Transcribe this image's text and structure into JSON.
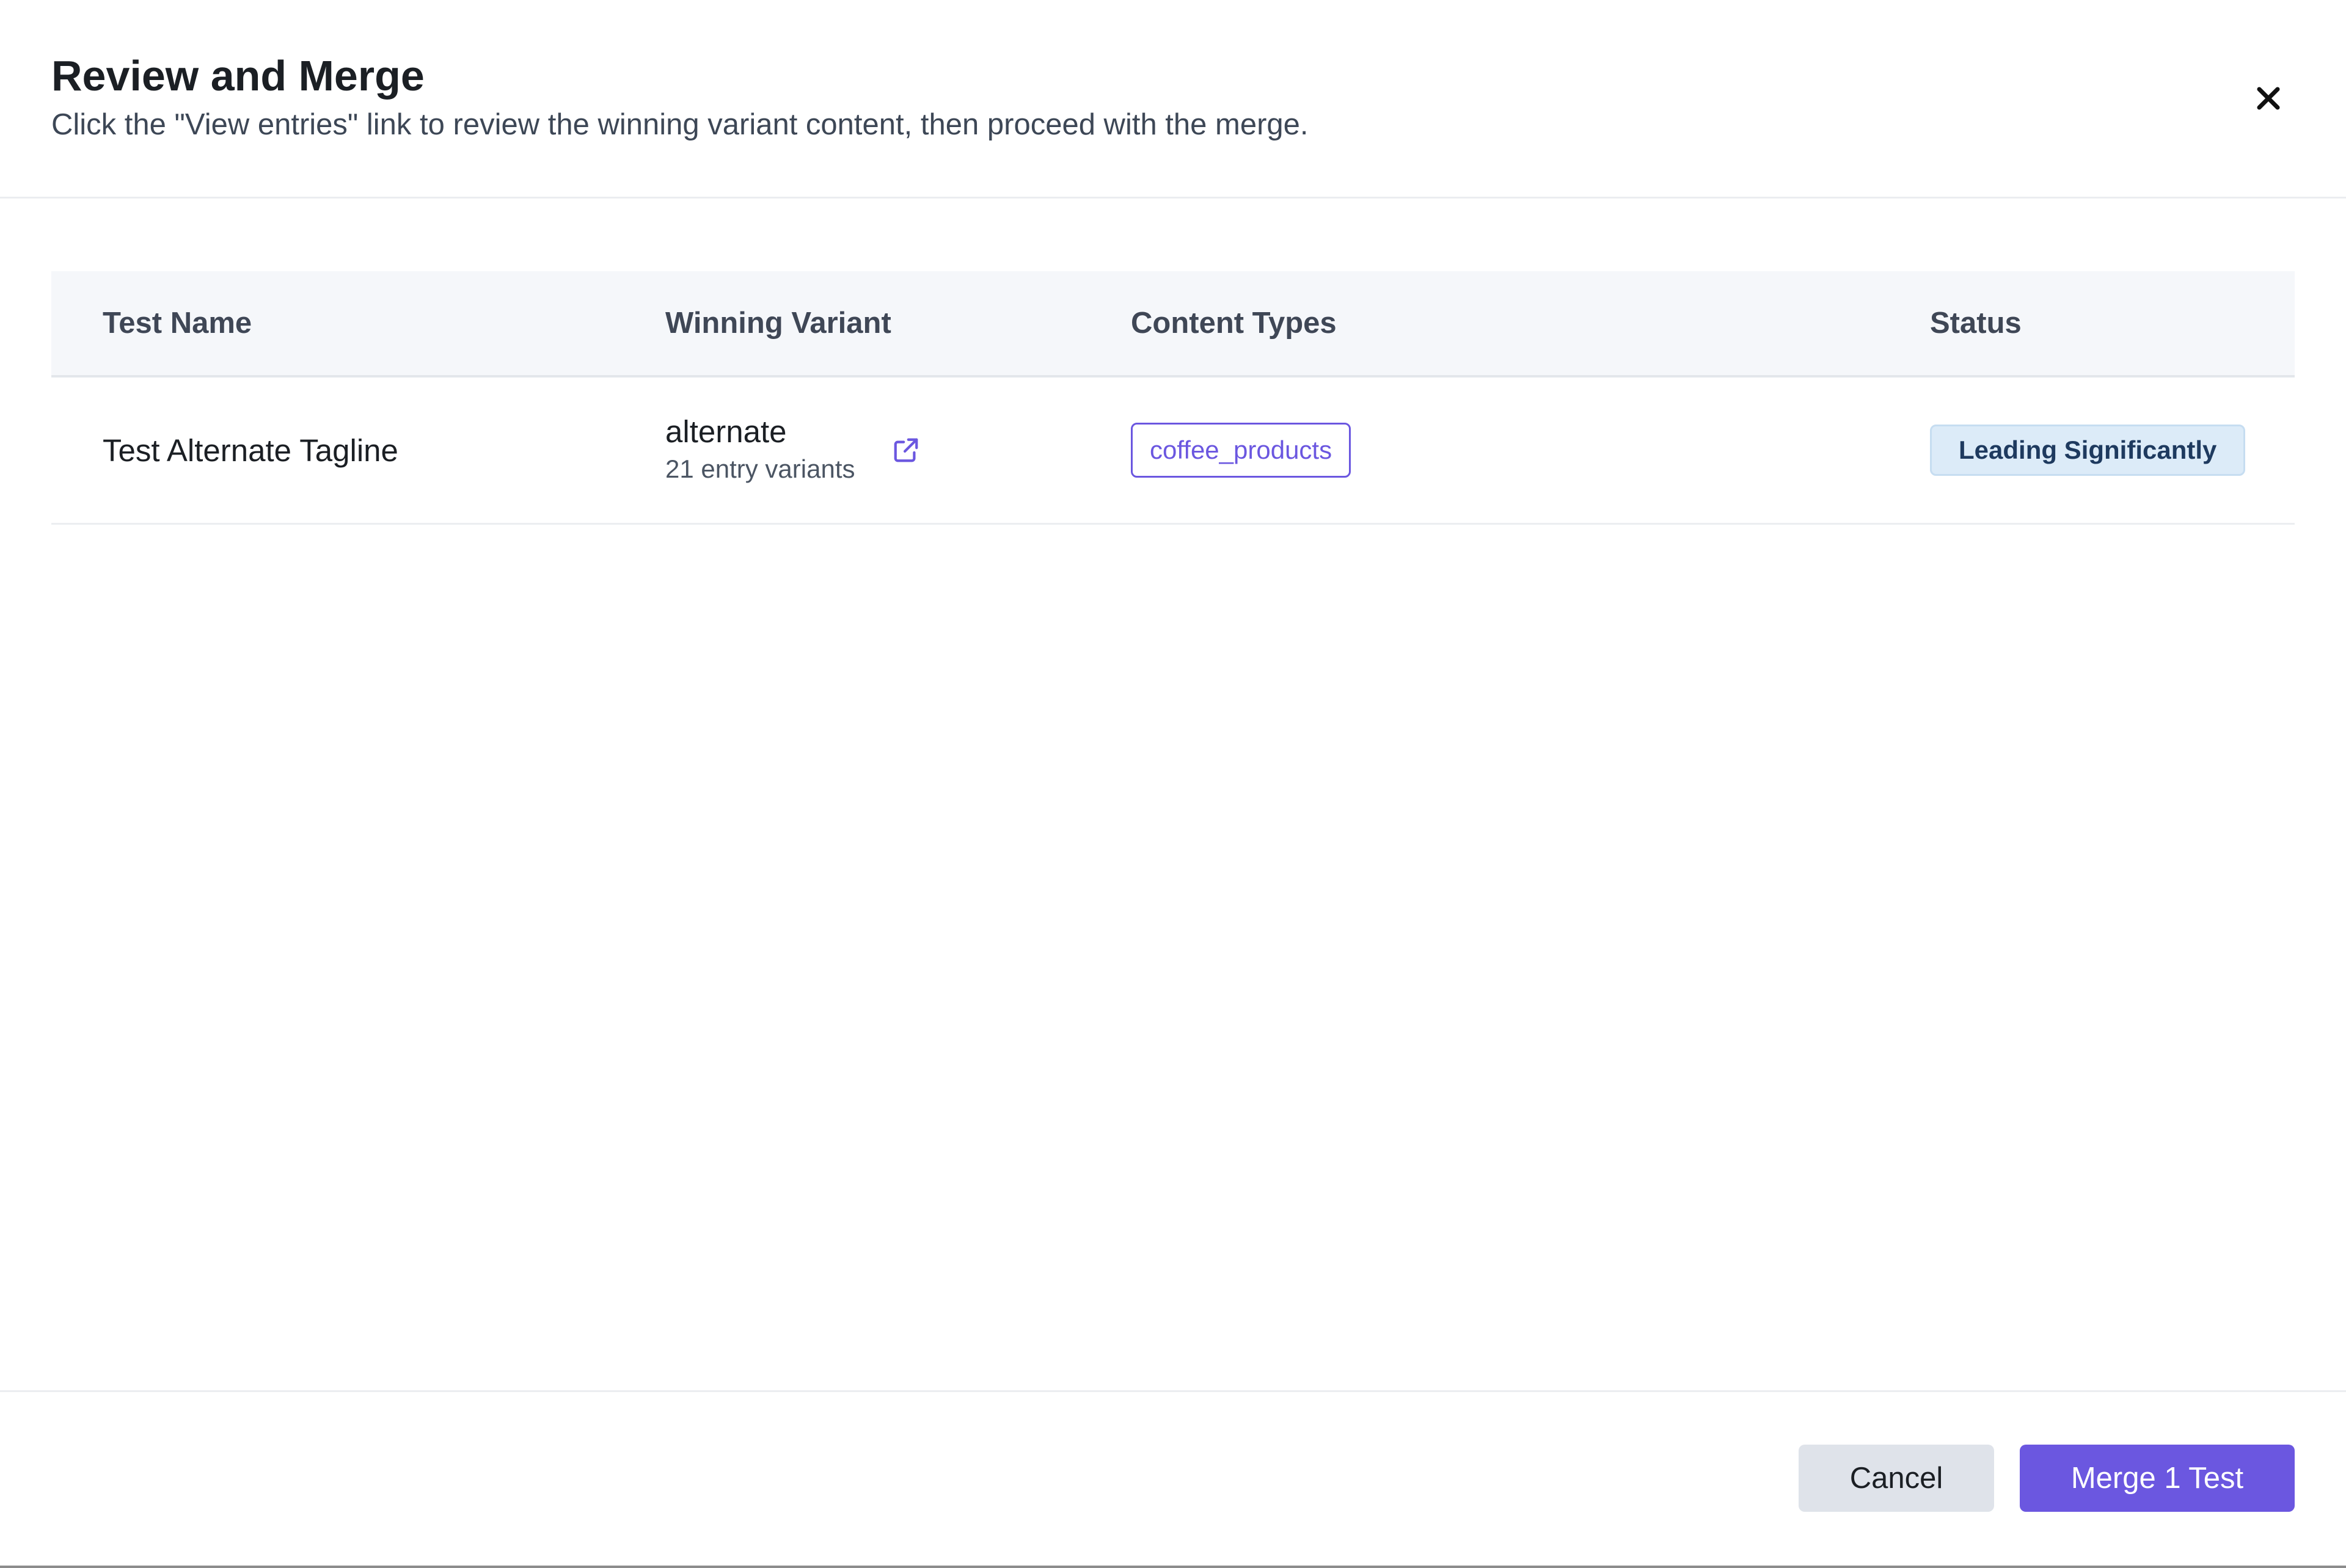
{
  "dialog": {
    "title": "Review and Merge",
    "subtitle": "Click the \"View entries\" link to review the winning variant content, then proceed with the merge.",
    "close_icon": "close-icon"
  },
  "table": {
    "columns": [
      "Test Name",
      "Winning Variant",
      "Content Types",
      "Status"
    ],
    "rows": [
      {
        "test_name": "Test Alternate Tagline",
        "winning_variant": "alternate",
        "variant_count": "21 entry variants",
        "link_icon": "external-link-icon",
        "content_type": "coffee_products",
        "status": "Leading Significantly"
      }
    ]
  },
  "footer": {
    "cancel_label": "Cancel",
    "merge_label": "Merge 1 Test"
  },
  "colors": {
    "accent": "#6b57e0",
    "status_bg": "#dcebf8",
    "status_text": "#1e3a5f",
    "cancel_bg": "#dfe3ea"
  }
}
